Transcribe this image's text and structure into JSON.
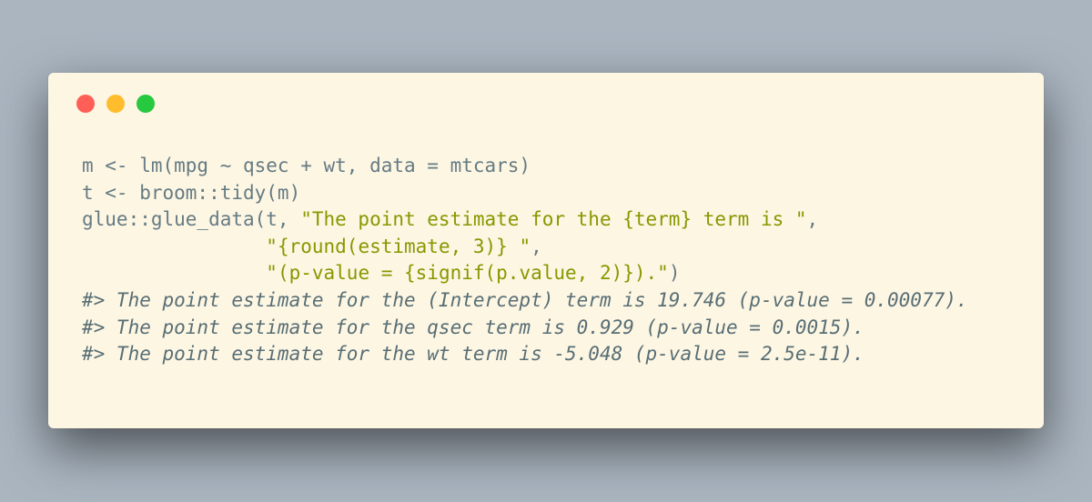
{
  "window": {
    "controls": {
      "close_color": "#ff5f56",
      "minimize_color": "#ffbd2e",
      "maximize_color": "#27c93f"
    }
  },
  "code": {
    "lines": [
      {
        "segments": [
          {
            "text": "m <- lm(mpg ~ qsec + wt, data = mtcars)",
            "kind": "code"
          }
        ]
      },
      {
        "segments": [
          {
            "text": "t <- broom::tidy(m)",
            "kind": "code"
          }
        ]
      },
      {
        "segments": [
          {
            "text": "glue::glue_data(t, ",
            "kind": "code"
          },
          {
            "text": "\"The point estimate for the {term} term is \"",
            "kind": "string"
          },
          {
            "text": ",",
            "kind": "code"
          }
        ]
      },
      {
        "segments": [
          {
            "text": "                ",
            "kind": "code"
          },
          {
            "text": "\"{round(estimate, 3)} \"",
            "kind": "string"
          },
          {
            "text": ",",
            "kind": "code"
          }
        ]
      },
      {
        "segments": [
          {
            "text": "                ",
            "kind": "code"
          },
          {
            "text": "\"(p-value = {signif(p.value, 2)}).\"",
            "kind": "string"
          },
          {
            "text": ")",
            "kind": "code"
          }
        ]
      },
      {
        "segments": [
          {
            "text": "#> The point estimate for the (Intercept) term is 19.746 (p-value = 0.00077).",
            "kind": "output"
          }
        ]
      },
      {
        "segments": [
          {
            "text": "#> The point estimate for the qsec term is 0.929 (p-value = 0.0015).",
            "kind": "output"
          }
        ]
      },
      {
        "segments": [
          {
            "text": "#> The point estimate for the wt term is -5.048 (p-value = 2.5e-11).",
            "kind": "output"
          }
        ]
      }
    ]
  },
  "colors": {
    "background": "#aab5c0",
    "panel": "#fdf6e3",
    "code_text": "#657b83",
    "string_text": "#859900",
    "output_text": "#586e75"
  }
}
